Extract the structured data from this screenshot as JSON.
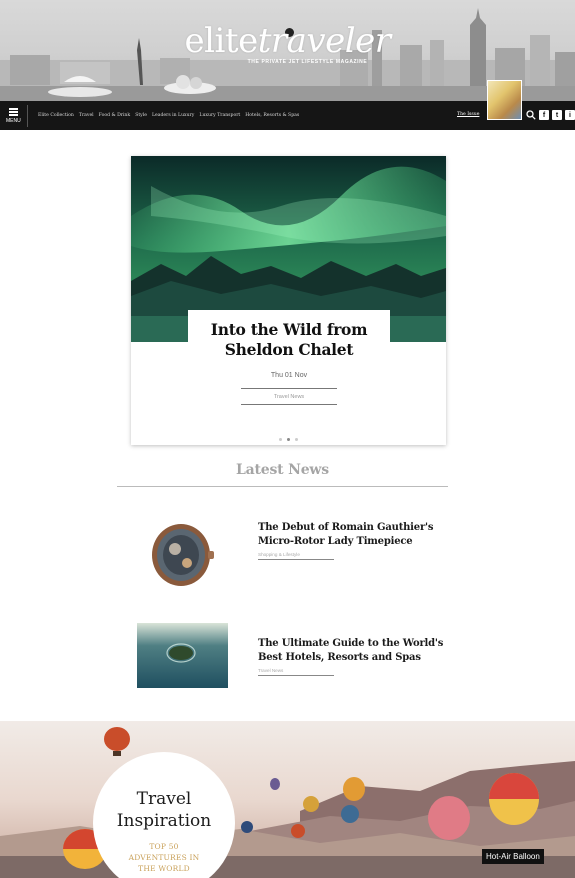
{
  "header": {
    "logo_part1": "elite",
    "logo_part2": "traveler",
    "tagline": "THE PRIVATE JET LIFESTYLE MAGAZINE"
  },
  "nav": {
    "menu_label": "MENU",
    "links": [
      "Elite Collection",
      "Travel",
      "Food & Drink",
      "Style",
      "Leaders in Luxury",
      "Luxury Transport",
      "Hotels, Resorts & Spas"
    ],
    "issue_link": "The Issue",
    "social": [
      "f",
      "t",
      "i"
    ]
  },
  "feature": {
    "title": "Into the Wild from Sheldon Chalet",
    "date": "Thu 01 Nov",
    "category": "Travel News"
  },
  "latest": {
    "heading": "Latest News",
    "items": [
      {
        "title": "The Debut of Romain Gauthier's Micro-Rotor Lady Timepiece",
        "category": "Shopping & Lifestyle"
      },
      {
        "title": "The Ultimate Guide to the World's Best Hotels, Resorts and Spas",
        "category": "Travel News"
      }
    ]
  },
  "inspiration": {
    "title_line1": "Travel",
    "title_line2": "Inspiration",
    "sub_line1": "TOP 50",
    "sub_line2": "ADVENTURES IN",
    "sub_line3": "THE WORLD",
    "caption": "Hot-Air Balloon"
  }
}
